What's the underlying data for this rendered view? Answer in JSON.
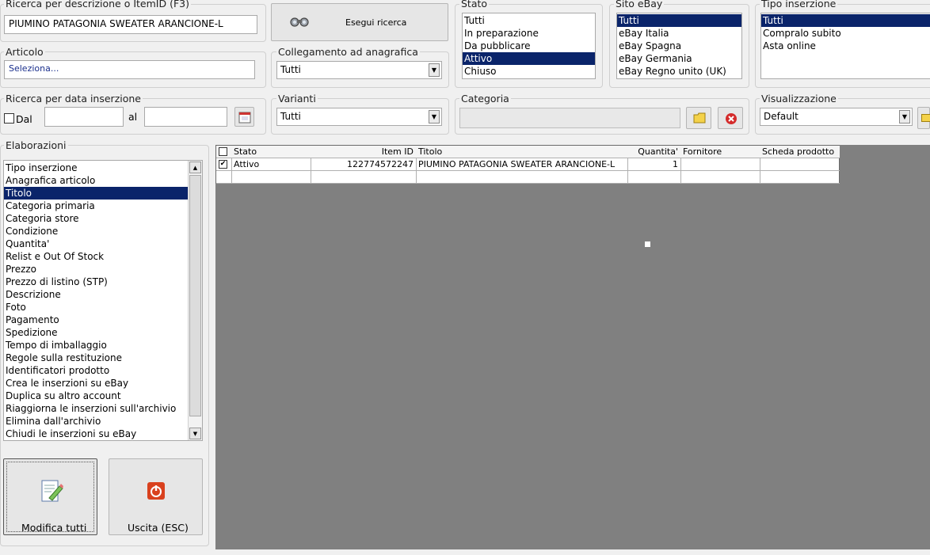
{
  "search_desc": {
    "label": "Ricerca per descrizione o ItemID (F3)",
    "value": "PIUMINO PATAGONIA SWEATER ARANCIONE-L"
  },
  "search_button": {
    "label": "Esegui ricerca",
    "icon": "binoculars-icon"
  },
  "articolo": {
    "label": "Articolo",
    "value": "Seleziona..."
  },
  "collegamento": {
    "label": "Collegamento ad anagrafica",
    "value": "Tutti"
  },
  "stato": {
    "label": "Stato",
    "items": [
      "Tutti",
      "In preparazione",
      "Da pubblicare",
      "Attivo",
      "Chiuso"
    ],
    "selected": "Attivo"
  },
  "sito": {
    "label": "Sito eBay",
    "items": [
      "Tutti",
      "eBay Italia",
      "eBay Spagna",
      "eBay Germania",
      "eBay Regno unito (UK)"
    ],
    "selected": "Tutti"
  },
  "tipo": {
    "label": "Tipo inserzione",
    "items": [
      "Tutti",
      "Compralo subito",
      "Asta online"
    ],
    "selected": "Tutti"
  },
  "data_inserzione": {
    "label": "Ricerca per data inserzione",
    "dal_label": "Dal",
    "al_label": "al",
    "dal_value": "",
    "al_value": ""
  },
  "varianti": {
    "label": "Varianti",
    "value": "Tutti"
  },
  "categoria": {
    "label": "Categoria",
    "value": ""
  },
  "visualizzazione": {
    "label": "Visualizzazione",
    "value": "Default"
  },
  "elaborazioni": {
    "label": "Elaborazioni",
    "items": [
      "Tipo inserzione",
      "Anagrafica articolo",
      "Titolo",
      "Categoria primaria",
      "Categoria store",
      "Condizione",
      "Quantita'",
      "Relist e Out Of Stock",
      "Prezzo",
      "Prezzo di listino (STP)",
      "Descrizione",
      "Foto",
      "Pagamento",
      "Spedizione",
      "Tempo di imballaggio",
      "Regole sulla restituzione",
      "Identificatori prodotto",
      "Crea le inserzioni su eBay",
      "Duplica su altro account",
      "Riaggiorna le inserzioni sull'archivio",
      "Elimina dall'archivio",
      "Chiudi le inserzioni su eBay"
    ],
    "selected": "Titolo"
  },
  "actions": {
    "modifica_tutti": "Modifica tutti",
    "uscita": "Uscita (ESC)"
  },
  "grid": {
    "columns": [
      "Stato",
      "Item ID",
      "Titolo",
      "Quantita'",
      "Fornitore",
      "Scheda prodotto"
    ],
    "rows": [
      {
        "checked": true,
        "stato": "Attivo",
        "item_id": "122774572247",
        "titolo": "PIUMINO PATAGONIA SWEATER ARANCIONE-L",
        "quantita": "1",
        "fornitore": "",
        "scheda": ""
      }
    ]
  },
  "colors": {
    "selection": "#0a246a",
    "grid_bg": "#808080"
  }
}
